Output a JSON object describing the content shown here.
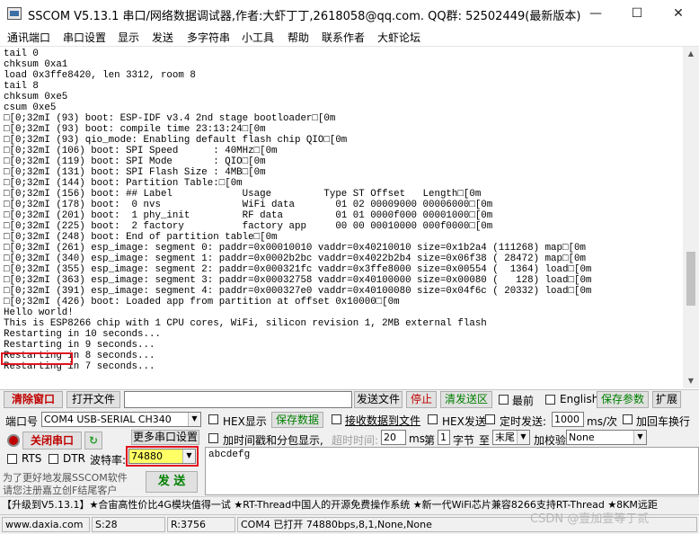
{
  "window": {
    "title": "SSCOM V5.13.1 串口/网络数据调试器,作者:大虾丁丁,2618058@qq.com. QQ群: 52502449(最新版本)",
    "minimize": "—",
    "maximize": "☐",
    "close": "✕"
  },
  "menu": [
    "通讯端口",
    "串口设置",
    "显示",
    "发送",
    "多字符串",
    "小工具",
    "帮助",
    "联系作者",
    "大虾论坛"
  ],
  "console": {
    "text": "tail 0\nchksum 0xa1\nload 0x3ffe8420, len 3312, room 8\ntail 8\nchksum 0xe5\ncsum 0xe5\n□[0;32mI (93) boot: ESP-IDF v3.4 2nd stage bootloader□[0m\n□[0;32mI (93) boot: compile time 23:13:24□[0m\n□[0;32mI (93) qio_mode: Enabling default flash chip QIO□[0m\n□[0;32mI (106) boot: SPI Speed      : 40MHz□[0m\n□[0;32mI (119) boot: SPI Mode       : QIO□[0m\n□[0;32mI (131) boot: SPI Flash Size : 4MB□[0m\n□[0;32mI (144) boot: Partition Table:□[0m\n□[0;32mI (156) boot: ## Label            Usage         Type ST Offset   Length□[0m\n□[0;32mI (178) boot:  0 nvs              WiFi data       01 02 00009000 00006000□[0m\n□[0;32mI (201) boot:  1 phy_init         RF data         01 01 0000f000 00001000□[0m\n□[0;32mI (225) boot:  2 factory          factory app     00 00 00010000 000f0000□[0m\n□[0;32mI (248) boot: End of partition table□[0m\n□[0;32mI (261) esp_image: segment 0: paddr=0x00010010 vaddr=0x40210010 size=0x1b2a4 (111268) map□[0m\n□[0;32mI (340) esp_image: segment 1: paddr=0x0002b2bc vaddr=0x4022b2b4 size=0x06f38 ( 28472) map□[0m\n□[0;32mI (355) esp_image: segment 2: paddr=0x000321fc vaddr=0x3ffe8000 size=0x00554 (  1364) load□[0m\n□[0;32mI (363) esp_image: segment 3: paddr=0x00032758 vaddr=0x40100000 size=0x00080 (   128) load□[0m\n□[0;32mI (391) esp_image: segment 4: paddr=0x000327e0 vaddr=0x40100080 size=0x04f6c ( 20332) load□[0m\n□[0;32mI (426) boot: Loaded app from partition at offset 0x10000□[0m\nHello world!\nThis is ESP8266 chip with 1 CPU cores, WiFi, silicon revision 1, 2MB external flash\nRestarting in 10 seconds...\nRestarting in 9 seconds...\nRestarting in 8 seconds...\nRestarting in 7 seconds..."
  },
  "toolbar": {
    "clear": "清除窗口",
    "open_file": "打开文件",
    "send_file": "发送文件",
    "stop": "停止",
    "clear_send": "清发送区",
    "topmost": "最前",
    "english": "English",
    "save_params": "保存参数",
    "expand": "扩展"
  },
  "controls": {
    "port_label": "端口号",
    "port_value": "COM4 USB-SERIAL CH340",
    "hex_display": "HEX显示",
    "save_data": "保存数据",
    "recv_to_file": "接收数据到文件",
    "hex_send": "HEX发送",
    "timed_send": "定时发送:",
    "interval": "1000",
    "interval_unit": "ms/次",
    "add_crlf": "加回车换行",
    "close_port": "关闭串口",
    "more_settings": "更多串口设置",
    "timestamp": "加时间戳和分包显示,",
    "timeout_label": "超时时间:",
    "timeout_value": "20",
    "ms": "ms",
    "nth": "第",
    "byte_index": "1",
    "byte": "字节",
    "to": "至",
    "end_value": "末尾",
    "checksum_label": "加校验",
    "checksum_value": "None",
    "rts": "RTS",
    "dtr": "DTR",
    "baud_label": "波特率:",
    "baud_value": "74880",
    "promo1": "为了更好地发展SSCOM软件",
    "promo2": "请您注册嘉立创F结尾客户",
    "send": "发 送",
    "send_text": "abcdefg"
  },
  "ticker": "【升级到V5.13.1】★合宙高性价比4G模块值得一试 ★RT-Thread中国人的开源免费操作系统 ★新一代WiFi芯片兼容8266支持RT-Thread ★8KM远距",
  "status": {
    "website": "www.daxia.com",
    "sent": "S:28",
    "received": "R:3756",
    "port_status": "COM4 已打开  74880bps,8,1,None,None"
  },
  "watermark": "CSDN @壹加壹等于贰"
}
